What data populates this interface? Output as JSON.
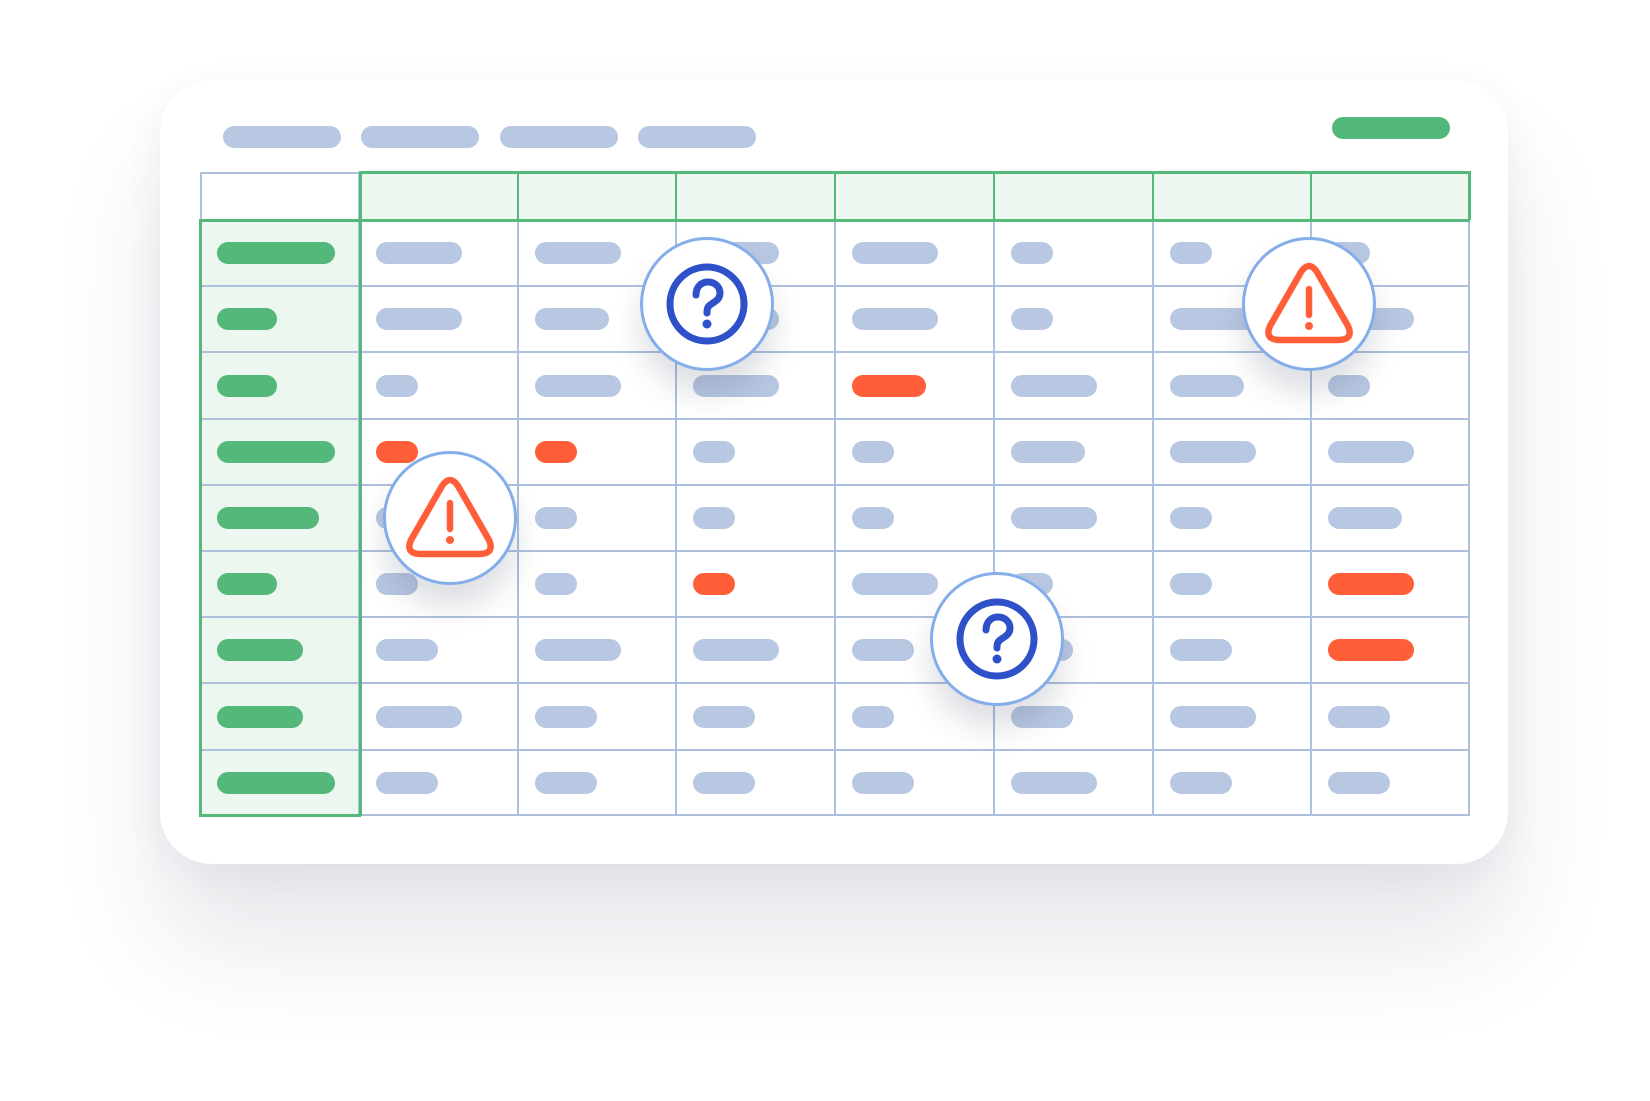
{
  "toolbar": {
    "tabs": [
      {
        "kind": "placeholder-tab"
      },
      {
        "kind": "placeholder-tab"
      },
      {
        "kind": "placeholder-tab"
      },
      {
        "kind": "placeholder-tab"
      }
    ],
    "action_color": "#54b87a"
  },
  "table": {
    "column_count": 8,
    "row_count": 9,
    "header_color": "#54b87a",
    "cell_color": "#b9c8e2",
    "flag_color": "#ff5e39",
    "flagged_cells": [
      {
        "row": 2,
        "col": 4
      },
      {
        "row": 3,
        "col": 1
      },
      {
        "row": 3,
        "col": 2
      },
      {
        "row": 5,
        "col": 3
      },
      {
        "row": 5,
        "col": 7
      },
      {
        "row": 6,
        "col": 7
      }
    ]
  },
  "badges": [
    {
      "type": "question",
      "icon": "question-circle-icon",
      "color": "#2e50c9"
    },
    {
      "type": "warning",
      "icon": "warning-triangle-icon",
      "color": "#ff5e39"
    },
    {
      "type": "warning",
      "icon": "warning-triangle-icon",
      "color": "#ff5e39"
    },
    {
      "type": "question",
      "icon": "question-circle-icon",
      "color": "#2e50c9"
    }
  ]
}
